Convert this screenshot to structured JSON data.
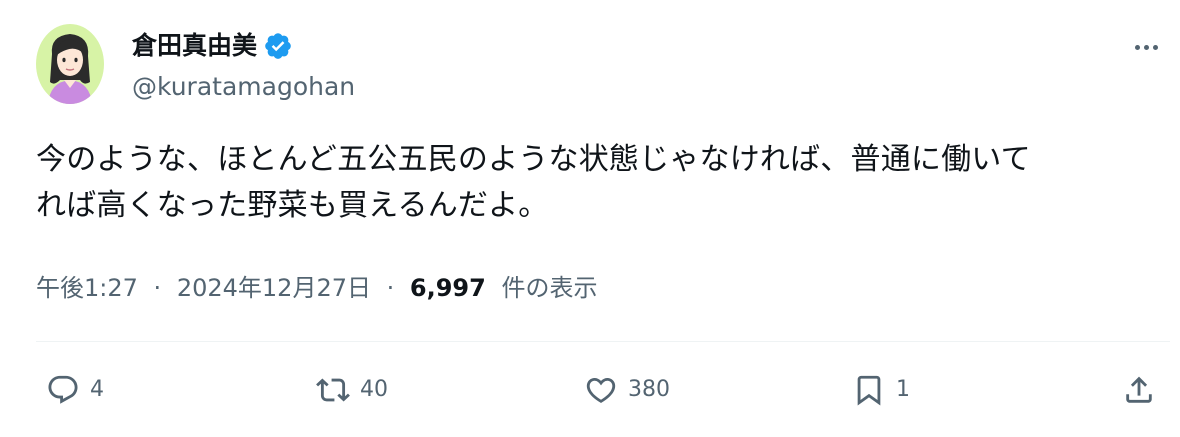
{
  "author": {
    "display_name": "倉田真由美",
    "handle": "@kuratamagohan",
    "verified_color": "#1d9bf0"
  },
  "tweet": {
    "text_line1": "今のような、ほとんど五公五民のような状態じゃなければ、普通に働いて",
    "text_line2": "れば高くなった野菜も買えるんだよ。",
    "time": "午後1:27",
    "sep": "·",
    "date": "2024年12月27日",
    "views_count": "6,997",
    "views_label": "件の表示"
  },
  "actions": {
    "replies": "4",
    "reposts": "40",
    "likes": "380",
    "bookmarks": "1"
  },
  "icons": {
    "more": "more-dots-icon",
    "reply": "reply-icon",
    "retweet": "retweet-icon",
    "like": "heart-icon",
    "bookmark": "bookmark-icon",
    "share": "share-icon",
    "verified": "verified-badge-icon"
  },
  "colors": {
    "text_primary": "#0f1419",
    "text_secondary": "#536471",
    "divider": "#eff3f4",
    "avatar_bg": "#d7f3a6"
  }
}
